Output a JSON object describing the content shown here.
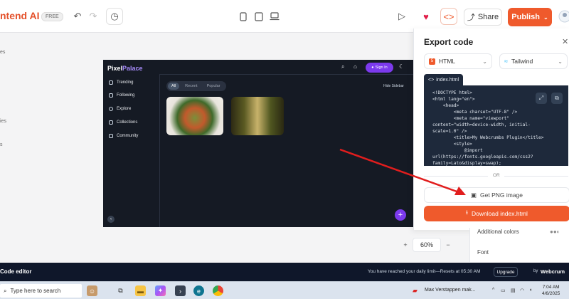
{
  "app": {
    "brand": "ntend AI ⁺",
    "badge": "FREE"
  },
  "toolbar": {
    "share_label": "Share",
    "publish_label": "Publish"
  },
  "left_fragments": [
    "es",
    "ies",
    "s"
  ],
  "preview": {
    "logo_prefix": "Pixel",
    "logo_highlight": "Palace",
    "nav": [
      "Trending",
      "Following",
      "Explore",
      "Collections",
      "Community"
    ],
    "signin_label": "Sign In",
    "tabs": [
      "All",
      "Recent",
      "Popular"
    ],
    "active_tab": "All",
    "hide_sidebar": "Hide Sidebar"
  },
  "export": {
    "title": "Export code",
    "framework": "HTML",
    "styling": "Tailwind",
    "file_tab": "index.html",
    "code_lines": [
      "<!DOCTYPE html>",
      "<html lang=\"en\">",
      "    <head>",
      "        <meta charset=\"UTF-8\" />",
      "        <meta name=\"viewport\"",
      "content=\"width=device-width, initial-",
      "scale=1.0\" />",
      "        <title>My Webcrumbs Plugin</title>",
      "        <style>",
      "            @import",
      "url(https://fonts.googleapis.com/css2?",
      "family=Lato&display=swap);"
    ],
    "or_label": "OR",
    "png_label": "Get PNG image",
    "download_label": "Download index.html"
  },
  "properties": {
    "additional_colors": "Additional colors",
    "font": "Font"
  },
  "zoom": {
    "minus": "−",
    "value": "60%",
    "plus": "+"
  },
  "bottom": {
    "label": "Code editor",
    "limit_text": "You have reached your daily limit—Resets at 05:30 AM",
    "upgrade_label": "Upgrade",
    "by": "by",
    "webcrumbs": "Webcrum"
  },
  "taskbar": {
    "search_placeholder": "Type here to search",
    "news_text": "Max Verstappen mak...",
    "time": "7:04 AM",
    "date": "4/6/2025"
  },
  "colors": {
    "accent": "#ef5a2c",
    "preview_bg": "#151a24",
    "purple": "#7c3aed",
    "arrow": "#e11d1d"
  }
}
